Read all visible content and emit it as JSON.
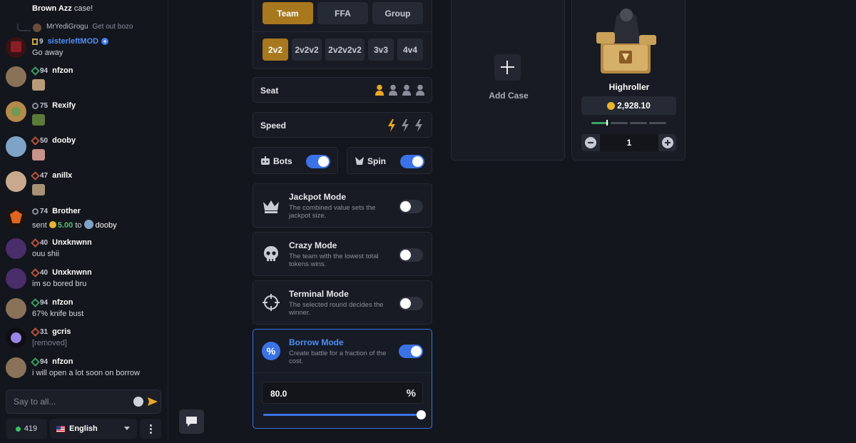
{
  "chat": {
    "partial_message": {
      "user": "Brown Azz",
      "text": "case!"
    },
    "reply": {
      "user": "MrYediGrogu",
      "text": "Get out bozo"
    },
    "messages": [
      {
        "level": "9",
        "user": "sisterleftMOD",
        "text": "Go away"
      },
      {
        "level": "94",
        "user": "nfzon",
        "text": ""
      },
      {
        "level": "75",
        "user": "Rexify",
        "text": ""
      },
      {
        "level": "50",
        "user": "dooby",
        "text": ""
      },
      {
        "level": "47",
        "user": "anillx",
        "text": ""
      },
      {
        "level": "74",
        "user": "Brother",
        "tip_prefix": "sent",
        "tip_amount": "5.00",
        "tip_to": "to",
        "tip_recipient": "dooby"
      },
      {
        "level": "40",
        "user": "Unxknwnn",
        "text": "ouu shii"
      },
      {
        "level": "40",
        "user": "Unxknwnn",
        "text": "im so bored bru"
      },
      {
        "level": "94",
        "user": "nfzon",
        "text": "67% knife bust"
      },
      {
        "level": "31",
        "user": "gcris",
        "text": "[removed]"
      },
      {
        "level": "94",
        "user": "nfzon",
        "text": "i will open a lot soon on borrow"
      }
    ],
    "input_placeholder": "Say to all...",
    "online_count": "419",
    "language": "English"
  },
  "battle": {
    "modes": [
      "Team",
      "FFA",
      "Group"
    ],
    "active_mode": "Team",
    "formats": [
      "2v2",
      "2v2v2",
      "2v2v2v2",
      "3v3",
      "4v4"
    ],
    "active_format": "2v2",
    "seat_label": "Seat",
    "speed_label": "Speed",
    "bots_label": "Bots",
    "bots_on": true,
    "spin_label": "Spin",
    "spin_on": true,
    "special_modes": [
      {
        "title": "Jackpot Mode",
        "desc": "The combined value sets the jackpot size.",
        "on": false,
        "icon": "crown-icon"
      },
      {
        "title": "Crazy Mode",
        "desc": "The team with the lowest total tokens wins.",
        "on": false,
        "icon": "skull-icon"
      },
      {
        "title": "Terminal Mode",
        "desc": "The selected round decides the winner.",
        "on": false,
        "icon": "crosshair-icon"
      }
    ],
    "borrow": {
      "title": "Borrow Mode",
      "desc": "Create battle for a fraction of the cost.",
      "on": true,
      "value": "80.0",
      "unit": "%",
      "slider_fraction": 1.0
    }
  },
  "cases": {
    "add_label": "Add Case",
    "case": {
      "name": "Highroller",
      "price": "2,928.10",
      "quantity": "1"
    }
  },
  "colors": {
    "accent_gold": "#a8781e",
    "toggle_on": "#3b73e6",
    "link_blue": "#4f8ff7",
    "online_green": "#37c466"
  }
}
